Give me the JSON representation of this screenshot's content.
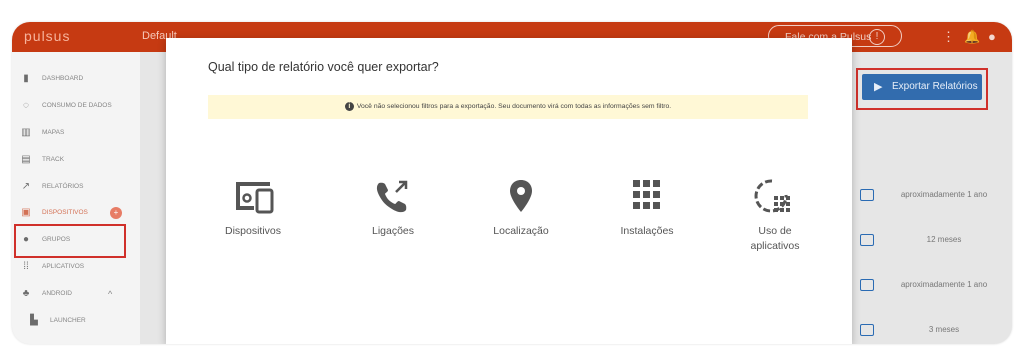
{
  "topbar": {
    "logo": "pulsus",
    "breadcrumb": "Default",
    "talk_label": "Fale com a Pulsus",
    "bg_color": "#c63a12"
  },
  "sidebar": {
    "items": [
      {
        "label": "DASHBOARD",
        "icon": "bar-chart-icon"
      },
      {
        "label": "CONSUMO DE DADOS",
        "icon": "data-usage-icon"
      },
      {
        "label": "MAPAS",
        "icon": "map-icon"
      },
      {
        "label": "TRACK",
        "icon": "track-icon"
      },
      {
        "label": "RELATÓRIOS",
        "icon": "trending-icon"
      },
      {
        "label": "DISPOSITIVOS",
        "icon": "devices-icon",
        "active": true
      },
      {
        "label": "GRUPOS",
        "icon": "groups-icon"
      },
      {
        "label": "APLICATIVOS",
        "icon": "apps-icon"
      },
      {
        "label": "ANDROID",
        "icon": "android-icon"
      },
      {
        "label": "LAUNCHER",
        "icon": "launcher-icon"
      }
    ],
    "badge": "+"
  },
  "content": {
    "export_button": "Exportar Relatórios",
    "rows": [
      "aproximadamente 1 ano",
      "12 meses",
      "aproximadamente 1 ano",
      "3 meses"
    ]
  },
  "modal": {
    "title": "Qual tipo de relatório você quer exportar?",
    "warning": "Você não selecionou filtros para a exportação. Seu documento virá com todas as informações sem filtro.",
    "options": [
      {
        "label": "Dispositivos",
        "icon": "devices-icon"
      },
      {
        "label": "Ligações",
        "icon": "phone-call-icon"
      },
      {
        "label": "Localização",
        "icon": "location-pin-icon"
      },
      {
        "label": "Instalações",
        "icon": "apps-grid-icon"
      },
      {
        "label": "Uso de aplicativos",
        "icon": "app-usage-icon"
      }
    ]
  },
  "colors": {
    "accent": "#c63a12",
    "export_button": "#1f5fa8",
    "highlight": "#d0302a",
    "warning_bg": "#fff8d6"
  }
}
